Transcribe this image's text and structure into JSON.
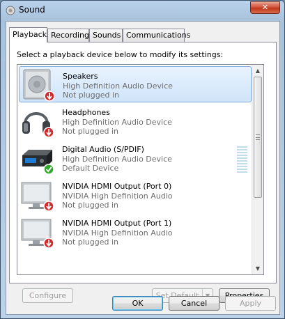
{
  "window": {
    "title": "Sound",
    "close_label": "✕"
  },
  "tabs": [
    {
      "label": "Playback",
      "active": true
    },
    {
      "label": "Recording",
      "active": false
    },
    {
      "label": "Sounds",
      "active": false
    },
    {
      "label": "Communications",
      "active": false
    }
  ],
  "instruction": "Select a playback device below to modify its settings:",
  "devices": [
    {
      "name": "Speakers",
      "driver": "High Definition Audio Device",
      "status": "Not plugged in",
      "icon": "speaker-icon",
      "badge": "unplugged-badge",
      "selected": true
    },
    {
      "name": "Headphones",
      "driver": "High Definition Audio Device",
      "status": "Not plugged in",
      "icon": "headphones-icon",
      "badge": "unplugged-badge",
      "selected": false
    },
    {
      "name": "Digital Audio (S/PDIF)",
      "driver": "High Definition Audio Device",
      "status": "Default Device",
      "icon": "digital-receiver-icon",
      "badge": "default-check-badge",
      "selected": false,
      "volume_level": 0.0
    },
    {
      "name": "NVIDIA HDMI Output (Port 0)",
      "driver": "NVIDIA High Definition Audio",
      "status": "Not plugged in",
      "icon": "monitor-icon",
      "badge": "unplugged-badge",
      "selected": false
    },
    {
      "name": "NVIDIA HDMI Output (Port 1)",
      "driver": "NVIDIA High Definition Audio",
      "status": "Not plugged in",
      "icon": "monitor-icon",
      "badge": "unplugged-badge",
      "selected": false
    }
  ],
  "buttons": {
    "configure": "Configure",
    "set_default": "Set Default",
    "properties": "Properties",
    "ok": "OK",
    "cancel": "Cancel",
    "apply": "Apply"
  },
  "colors": {
    "selection": "#cfe4fa",
    "badge_red": "#d4282b",
    "badge_green": "#2fa82a"
  }
}
